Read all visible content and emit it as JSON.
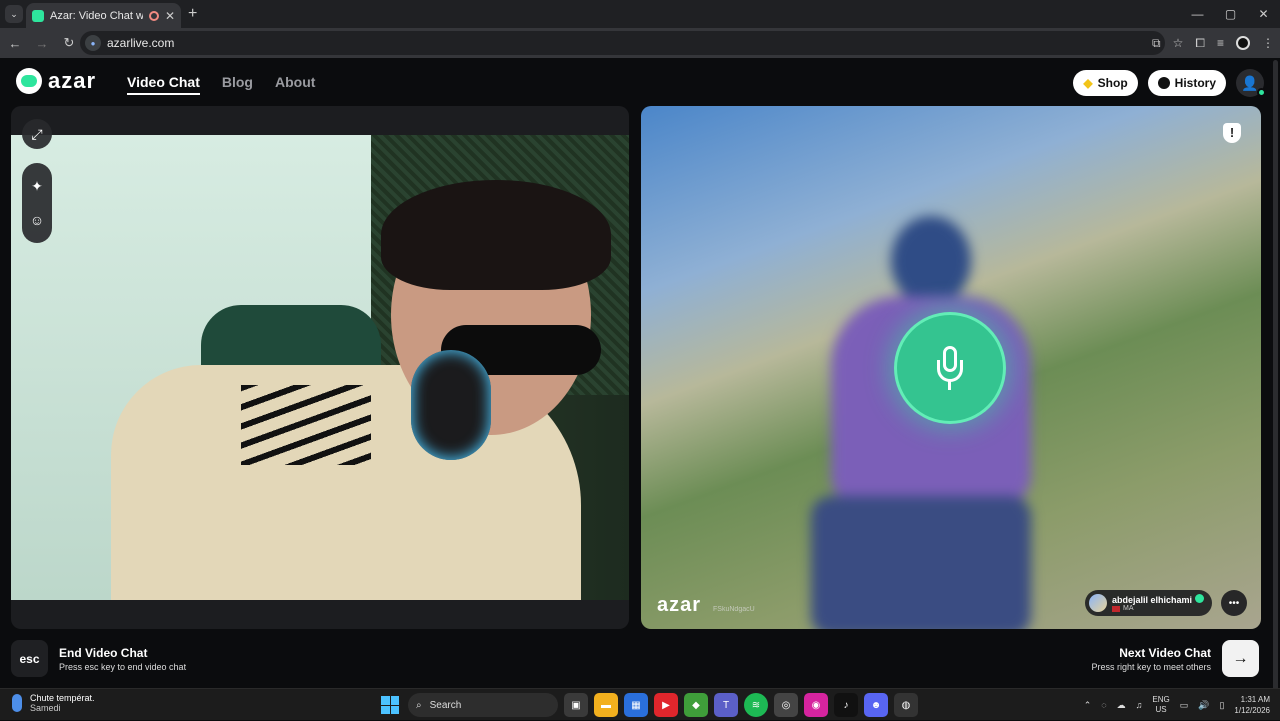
{
  "browser": {
    "tab_title": "Azar: Video Chat with New",
    "tab_close": "✕",
    "new_tab": "+",
    "url": "azarlive.com",
    "window_controls": [
      "—",
      "▢",
      "✕"
    ]
  },
  "header": {
    "logo_text": "azar",
    "nav": [
      {
        "label": "Video Chat",
        "active": true
      },
      {
        "label": "Blog",
        "active": false
      },
      {
        "label": "About",
        "active": false
      }
    ],
    "shop_label": "Shop",
    "history_label": "History"
  },
  "peer": {
    "name": "abdejalil elhichami",
    "country": "MA",
    "watermark": "azar",
    "watermark_id": "FSkuNdgacU"
  },
  "controls": {
    "esc_key": "esc",
    "end_title": "End Video Chat",
    "end_subtitle": "Press esc key to end video chat",
    "next_title": "Next Video Chat",
    "next_subtitle": "Press right key to meet others",
    "next_arrow": "→"
  },
  "taskbar": {
    "weather_line1": "Chute températ.",
    "weather_line2": "Samedi",
    "search_placeholder": "Search",
    "lang_line1": "ENG",
    "lang_line2": "US",
    "time": "1:31 AM",
    "date": "1/12/2026"
  },
  "colors": {
    "accent": "#2ee59d",
    "background": "#0b0c0e",
    "panel": "#1c1d20"
  },
  "icons": {
    "expand": "expand-icon",
    "effects": "sparkle-icon",
    "sticker": "sticker-icon",
    "report": "shield-icon",
    "mic": "microphone-icon",
    "chat": "chat-bubble-icon"
  }
}
